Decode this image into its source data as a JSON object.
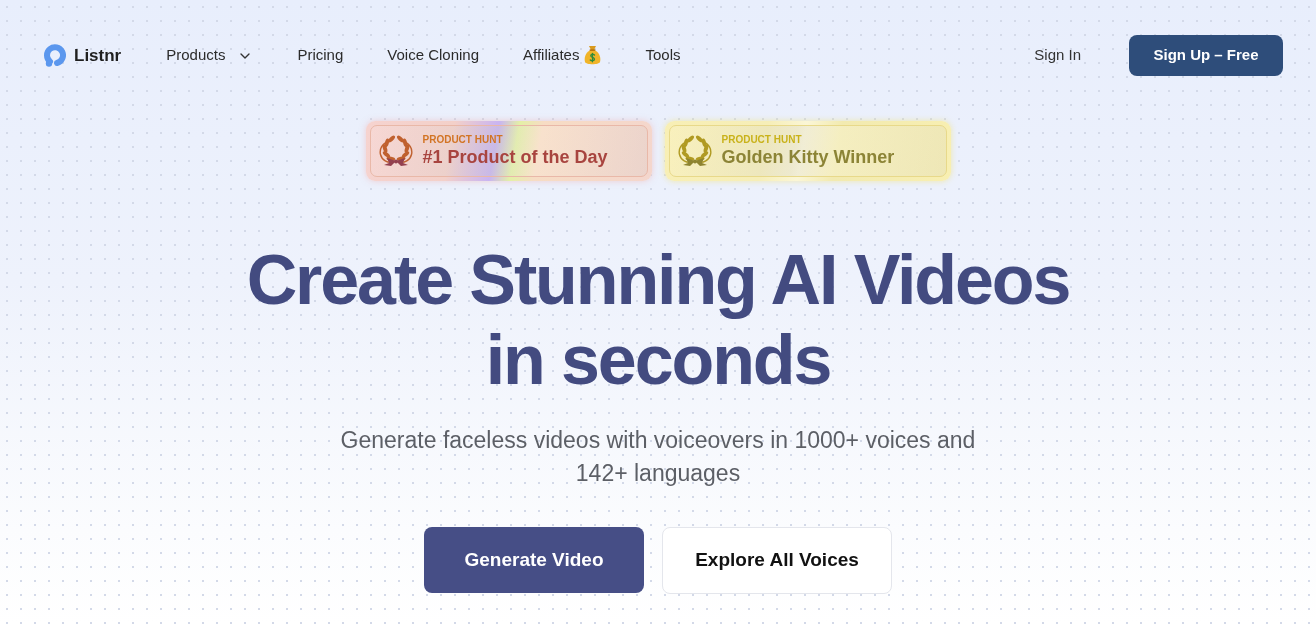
{
  "header": {
    "logo": {
      "name": "Listnr"
    },
    "nav": [
      {
        "label": "Products",
        "kind": "dropdown"
      },
      {
        "label": "Pricing",
        "kind": "link"
      },
      {
        "label": "Voice Cloning",
        "kind": "link"
      },
      {
        "label": "Affiliates",
        "kind": "money"
      },
      {
        "label": "Tools",
        "kind": "link"
      }
    ],
    "sign_in": "Sign In",
    "sign_up": "Sign Up – Free"
  },
  "badges": [
    {
      "kind": "rank",
      "eyebrow": "PRODUCT HUNT",
      "title": "#1 Product of the Day"
    },
    {
      "kind": "award",
      "eyebrow": "PRODUCT HUNT",
      "title": "Golden Kitty Winner"
    }
  ],
  "hero": {
    "headline": [
      "Create Stunning AI Videos",
      "in seconds"
    ],
    "subtitle": "Generate faceless videos with voiceovers in 1000+ voices and 142+ languages"
  },
  "actions": [
    {
      "label": "Generate Video",
      "kind": "primary"
    },
    {
      "label": "Explore All Voices",
      "kind": "secondary"
    }
  ]
}
